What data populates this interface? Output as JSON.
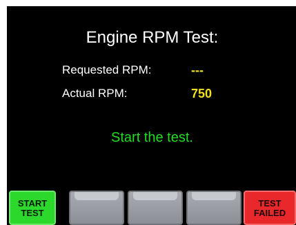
{
  "screen": {
    "title": "Engine RPM Test:",
    "requested_rpm_label": "Requested RPM:",
    "requested_rpm_value": "---",
    "actual_rpm_label": "Actual RPM:",
    "actual_rpm_value": "750",
    "status_message": "Start the test."
  },
  "softkeys": {
    "start": {
      "line1": "START",
      "line2": "TEST"
    },
    "failed": {
      "line1": "TEST",
      "line2": "FAILED"
    }
  },
  "colors": {
    "background": "#000000",
    "value_yellow": "#f0e020",
    "status_green": "#22dd22",
    "start_green": "#2bd82b",
    "failed_red": "#e8282a",
    "blank_gray": "#9a9ea4"
  }
}
